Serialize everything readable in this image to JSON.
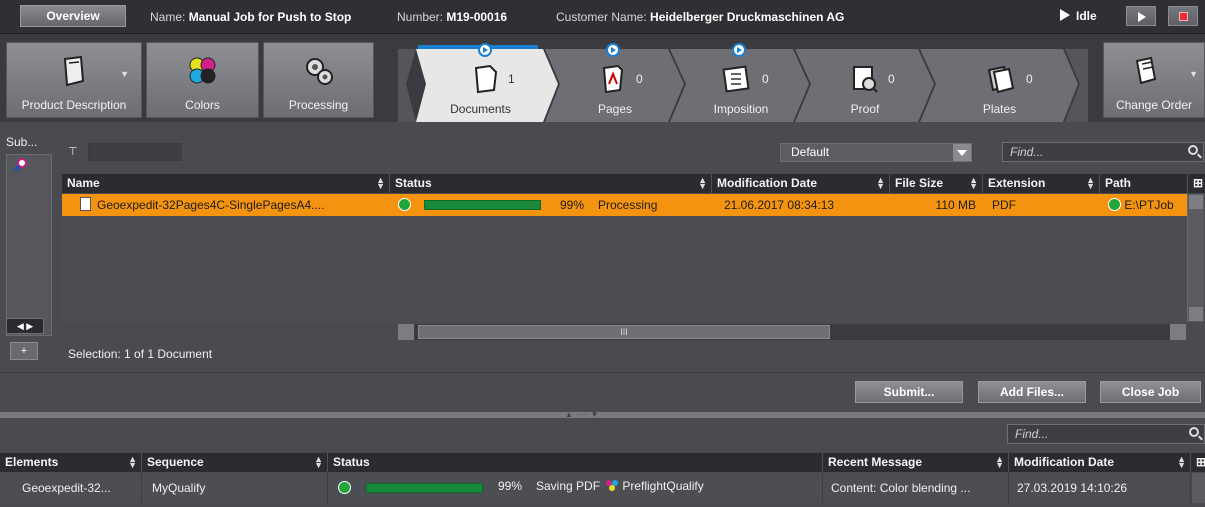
{
  "header": {
    "overview_label": "Overview",
    "name_label": "Name:",
    "name_value": "Manual Job for Push to Stop",
    "number_label": "Number:",
    "number_value": "M19-00016",
    "customer_label": "Customer Name:",
    "customer_value": "Heidelberger Druckmaschinen AG",
    "status": "Idle"
  },
  "toolbar": {
    "product_description": "Product Description",
    "colors": "Colors",
    "processing": "Processing",
    "change_order": "Change Order"
  },
  "steps": [
    {
      "label": "Documents",
      "count": "1"
    },
    {
      "label": "Pages",
      "count": "0"
    },
    {
      "label": "Imposition",
      "count": "0"
    },
    {
      "label": "Proof",
      "count": "0"
    },
    {
      "label": "Plates",
      "count": "0"
    }
  ],
  "left_panel": {
    "title": "Sub..."
  },
  "documents": {
    "view_select": "Default",
    "find_placeholder": "Find...",
    "columns": [
      "Name",
      "Status",
      "Modification Date",
      "File Size",
      "Extension",
      "Path"
    ],
    "rows": [
      {
        "name": "Geoexpedit-32Pages4C-SinglePagesA4....",
        "progress_percent": 99,
        "progress_text": "99%",
        "status_text": "Processing",
        "modified": "21.06.2017 08:34:13",
        "size": "110 MB",
        "extension": "PDF",
        "path": "E:\\PTJob"
      }
    ],
    "scroll_thumb_label": "III",
    "selection": "Selection:  1 of 1 Document"
  },
  "actions": {
    "submit": "Submit...",
    "add_files": "Add Files...",
    "close_job": "Close Job"
  },
  "elements_table": {
    "find_placeholder": "Find...",
    "columns": [
      "Elements",
      "Sequence",
      "Status",
      "Recent Message",
      "Modification Date"
    ],
    "rows": [
      {
        "element": "Geoexpedit-32...",
        "sequence": "MyQualify",
        "progress_percent": 99,
        "progress_text": "99%",
        "status_text": "Saving PDF",
        "status_step": "PreflightQualify",
        "recent_message": "Content: Color blending ...",
        "modified": "27.03.2019 14:10:26"
      }
    ]
  },
  "colors": {
    "selected_row": "#f39310",
    "progress": "#188a3a",
    "active_dot": "#1a7fd0",
    "stop": "#e8303a"
  }
}
